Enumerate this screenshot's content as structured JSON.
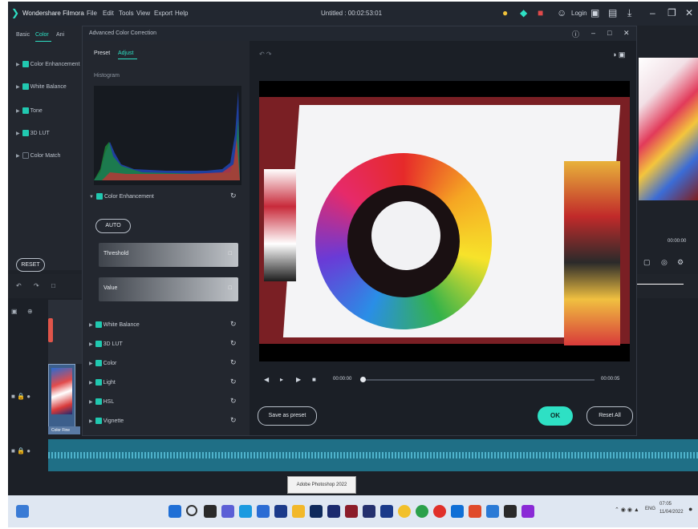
{
  "app": {
    "name": "Wondershare Filmora",
    "menu": [
      "File",
      "Edit",
      "Tools",
      "View",
      "Export",
      "Help"
    ],
    "project_title": "Untitled : 00:02:53:01",
    "login": "Login"
  },
  "left_panel": {
    "tabs": [
      "Basic",
      "Color",
      "Ani"
    ],
    "items": [
      {
        "label": "Color Enhancement",
        "checked": true
      },
      {
        "label": "White Balance",
        "checked": true
      },
      {
        "label": "Tone",
        "checked": true
      },
      {
        "label": "3D LUT",
        "checked": true
      },
      {
        "label": "Color Match",
        "checked": false
      }
    ],
    "reset_label": "RESET"
  },
  "dialog": {
    "title": "Advanced Color Correction",
    "tabs": {
      "preset": "Preset",
      "adjust": "Adjust"
    },
    "histogram_label": "Histogram",
    "color_enhancement": "Color Enhancement",
    "auto_label": "AUTO",
    "threshold_label": "Threshold",
    "value_label": "Value",
    "sections": [
      "White Balance",
      "3D LUT",
      "Color",
      "Light",
      "HSL",
      "Vignette"
    ],
    "time_current": "00:00:00",
    "time_total": "00:00:05",
    "save_preset": "Save as preset",
    "ok": "OK",
    "reset_all": "Reset All"
  },
  "right_panel": {
    "time": "00:00:00"
  },
  "taskbar": {
    "tooltip": "Adobe Photoshop 2022",
    "tray_text": "ENG",
    "clock_time": "07:05",
    "clock_date": "11/04/2022"
  },
  "timeline": {
    "clip_label": "Color Fine"
  },
  "colors": {
    "accent": "#2ee0c4",
    "panel": "#23272f",
    "background": "#1e2229"
  }
}
